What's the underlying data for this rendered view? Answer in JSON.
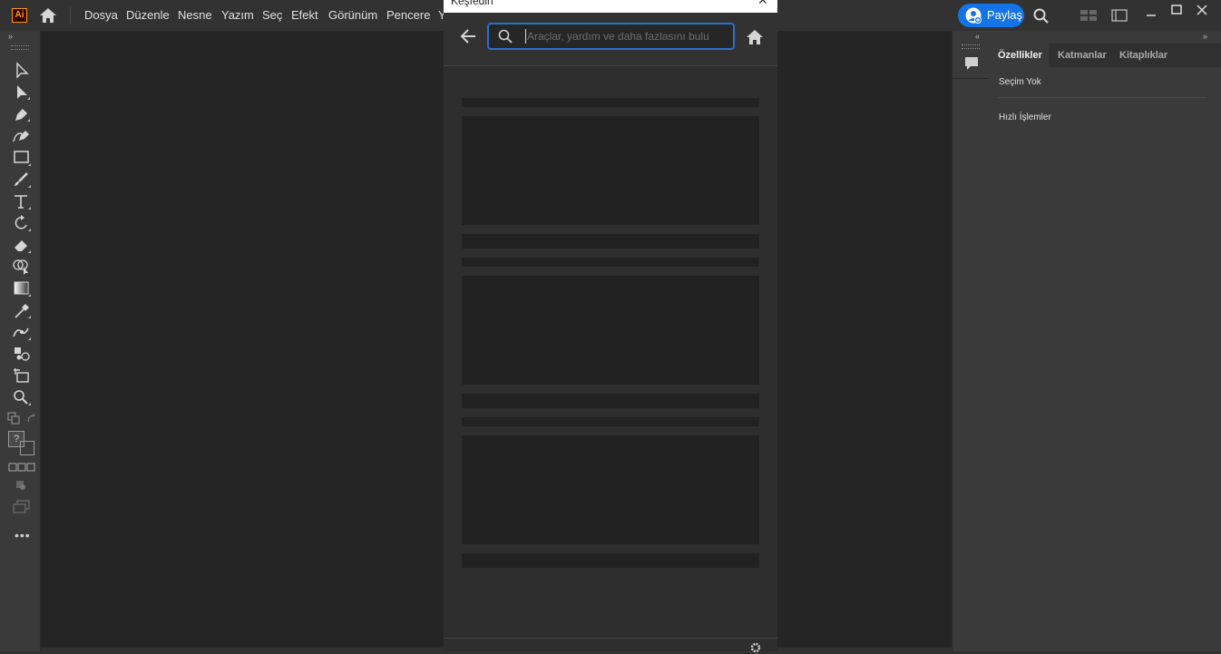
{
  "app": {
    "logo_text": "Ai"
  },
  "menu": {
    "items": [
      "Dosya",
      "Düzenle",
      "Nesne",
      "Yazım",
      "Seç",
      "Efekt",
      "Görünüm",
      "Pencere",
      "Y"
    ]
  },
  "header_right": {
    "share_label": "Paylaş"
  },
  "colors": {
    "accent": "#1473e6",
    "logo_border": "#ff9a00",
    "search_focus": "#2d6fcc"
  },
  "dialog": {
    "title": "Keşfedin",
    "search_placeholder": "Araçlar, yardım ve daha fazlasını bulu"
  },
  "properties": {
    "tabs": [
      "Özellikler",
      "Katmanlar",
      "Kitaplıklar"
    ],
    "active_tab": "Özellikler",
    "selection": "Seçim Yok",
    "quick_actions": "Hızlı İşlemler"
  },
  "toolbar": {
    "help_glyph": "?",
    "tools": [
      "selection-icon",
      "direct-selection-icon",
      "pen-icon",
      "curvature-icon",
      "rectangle-icon",
      "paintbrush-icon",
      "type-icon",
      "rotate-icon",
      "eraser-icon",
      "shape-builder-icon",
      "gradient-icon",
      "eyedropper-icon",
      "puppet-warp-icon",
      "symbol-sprayer-icon",
      "artboard-icon",
      "zoom-icon"
    ]
  }
}
